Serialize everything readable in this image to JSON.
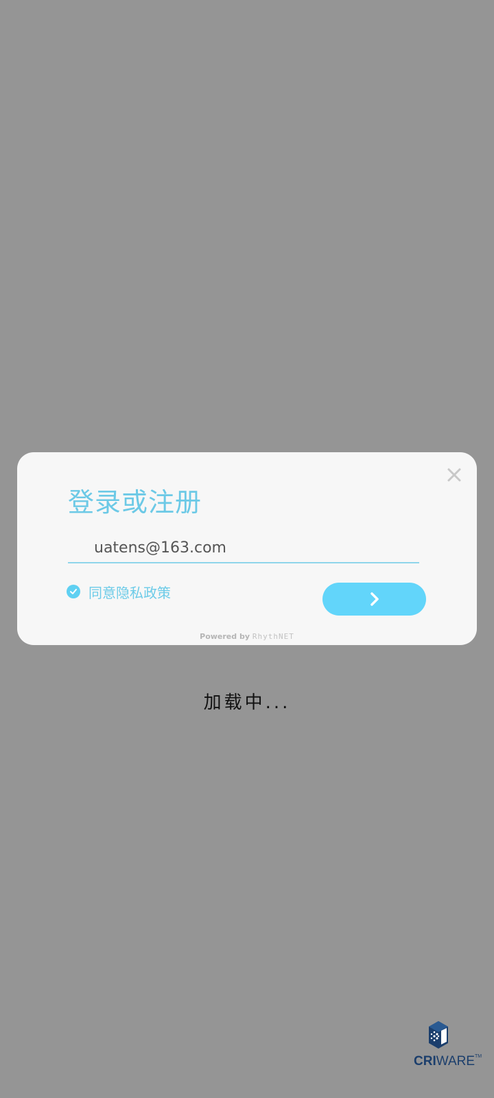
{
  "dialog": {
    "title": "登录或注册",
    "email": {
      "value": "uatens@163.com",
      "placeholder": ""
    },
    "agree_label": "同意隐私政策",
    "agree_checked": true,
    "powered_prefix": "Powered by",
    "powered_brand": "RhythNET",
    "icons": {
      "close": "close-icon",
      "check": "check-circle-icon",
      "submit": "chevron-right-icon"
    }
  },
  "loading_text": "加载中...",
  "logo": {
    "primary": "CRI",
    "secondary": "WARE",
    "tm": "TM"
  },
  "colors": {
    "background": "#959595",
    "dialog": "#f7f7f7",
    "accent": "#62d5fa",
    "title": "#6cc9e6",
    "logo": "#1b3e6c"
  }
}
